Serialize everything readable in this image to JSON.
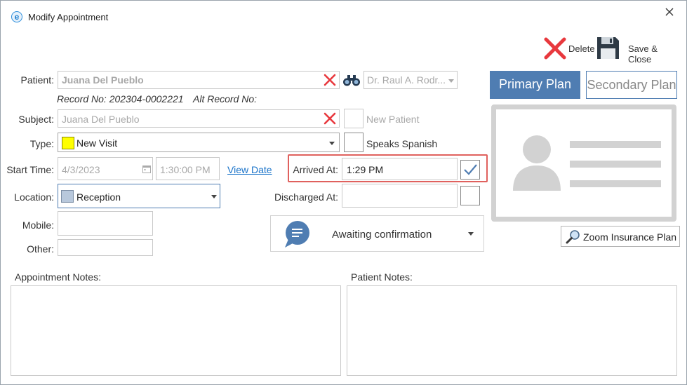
{
  "window": {
    "title": "Modify Appointment"
  },
  "toolbar": {
    "delete_label": "Delete",
    "save_close_label": "Save & Close"
  },
  "patient": {
    "label": "Patient:",
    "value": "Juana Del Pueblo",
    "record_no": "Record No: 202304-0002221",
    "alt_record_no": "Alt Record No:",
    "doctor": "Dr. Raul A. Rodr..."
  },
  "subject": {
    "label": "Subject:",
    "value": "Juana Del Pueblo",
    "new_patient_label": "New Patient"
  },
  "type": {
    "label": "Type:",
    "value": "New Visit",
    "color": "#ffff00",
    "speaks_spanish_label": "Speaks Spanish"
  },
  "start_time": {
    "label": "Start Time:",
    "date": "4/3/2023",
    "time": "1:30:00 PM",
    "view_date_label": "View Date"
  },
  "arrived_at": {
    "label": "Arrived At:",
    "value": "1:29 PM",
    "checked": true
  },
  "location": {
    "label": "Location:",
    "value": "Reception",
    "color": "#b8c8dc"
  },
  "discharged_at": {
    "label": "Discharged At:",
    "value": ""
  },
  "mobile": {
    "label": "Mobile:",
    "value": ""
  },
  "other": {
    "label": "Other:",
    "value": ""
  },
  "status": {
    "value": "Awaiting confirmation"
  },
  "insurance": {
    "primary_label": "Primary Plan",
    "secondary_label": "Secondary Plan",
    "zoom_label": "Zoom Insurance Plan"
  },
  "notes": {
    "appointment_label": "Appointment Notes:",
    "patient_label": "Patient Notes:"
  },
  "colors": {
    "accent_blue": "#4f7db2",
    "highlight_red": "#e0615e",
    "delete_red": "#e8383d",
    "link_blue": "#1a73c9"
  }
}
